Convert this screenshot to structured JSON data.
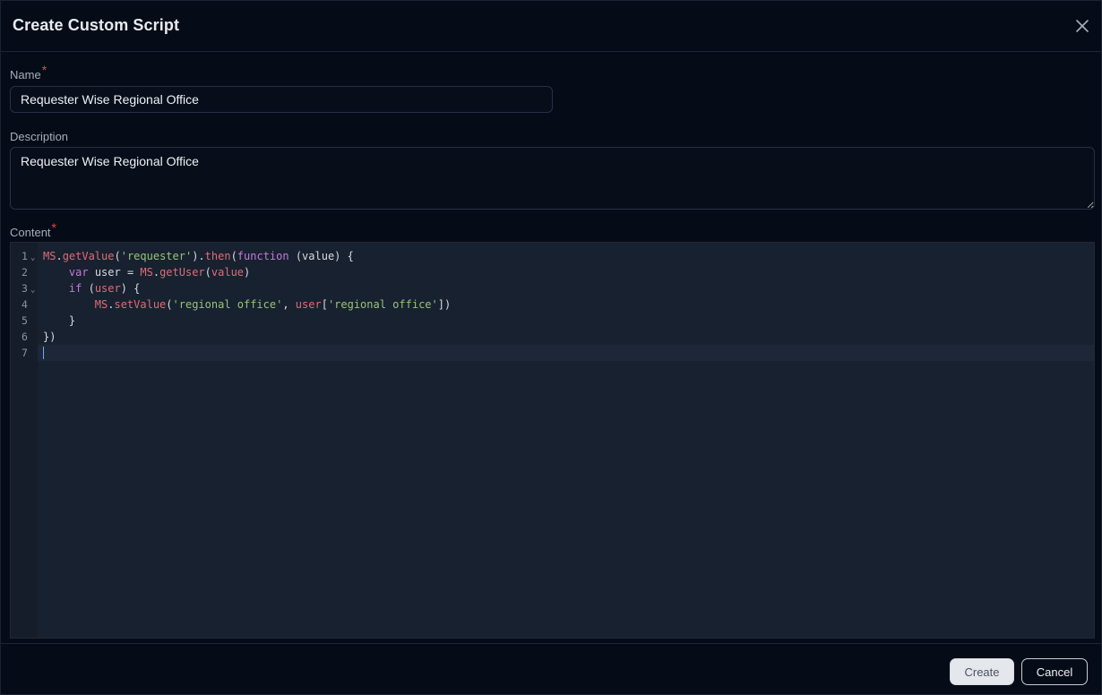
{
  "dialog": {
    "title": "Create Custom Script",
    "close_icon": "close-icon"
  },
  "form": {
    "name": {
      "label": "Name",
      "required_mark": "*",
      "value": "Requester Wise Regional Office"
    },
    "description": {
      "label": "Description",
      "value": "Requester Wise Regional Office"
    },
    "content": {
      "label": "Content",
      "required_mark": "*",
      "line_numbers": [
        "1",
        "2",
        "3",
        "4",
        "5",
        "6",
        "7"
      ],
      "lines": [
        "MS.getValue('requester').then(function (value) {",
        "    var user = MS.getUser(value)",
        "    if (user) {",
        "        MS.setValue('regional office', user['regional office'])",
        "    }",
        "})",
        ""
      ],
      "tokens": {
        "ms": "MS",
        "getValue": "getValue",
        "requester": "'requester'",
        "then": "then",
        "function": "function",
        "var": "var",
        "getUser": "getUser",
        "if": "if",
        "user": "user",
        "setValue": "setValue",
        "regional_office": "'regional office'"
      },
      "active_line": 7
    }
  },
  "footer": {
    "create_label": "Create",
    "cancel_label": "Cancel"
  },
  "colors": {
    "background": "#060c17",
    "editor_bg": "#18212f",
    "keyword": "#c678dd",
    "identifier": "#e06c75",
    "string": "#98c379",
    "required": "#ef4444"
  }
}
